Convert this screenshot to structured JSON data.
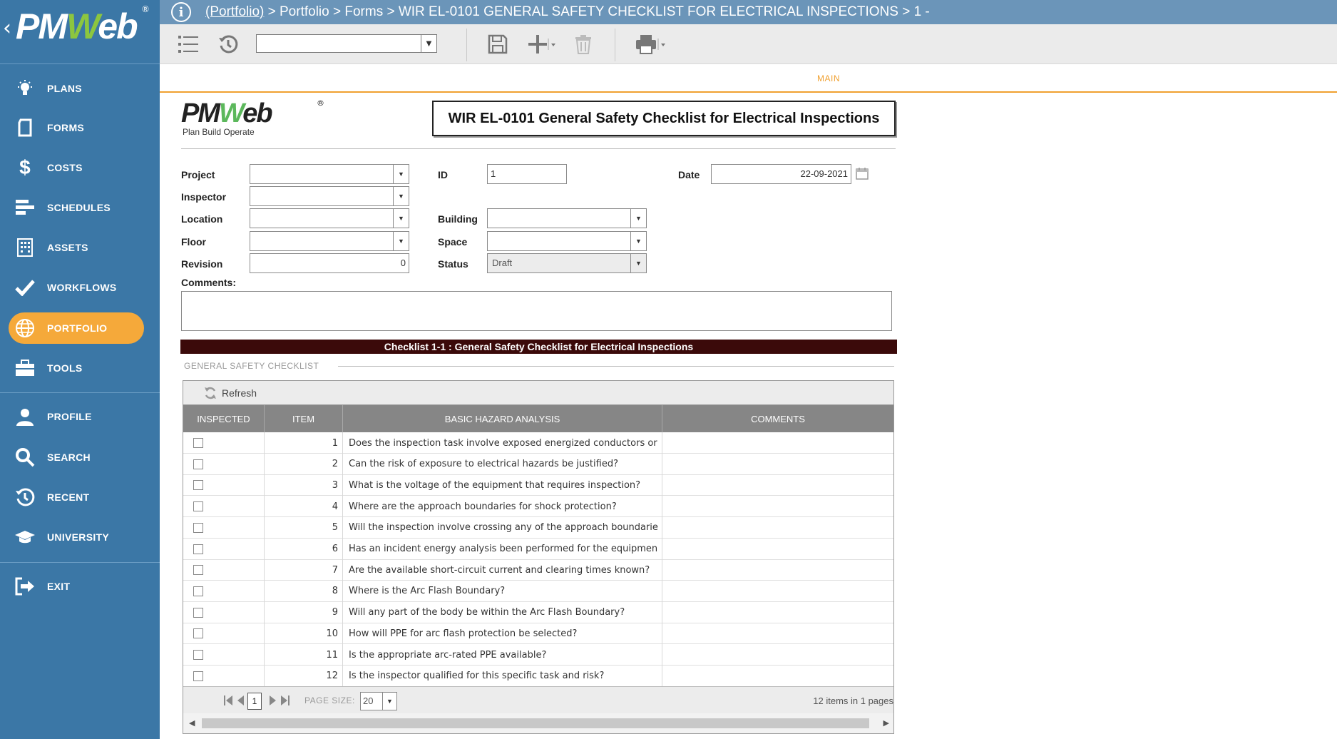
{
  "sidebar": {
    "brand": "PMWeb",
    "items": [
      {
        "label": "PLANS",
        "icon": "lightbulb-icon"
      },
      {
        "label": "FORMS",
        "icon": "document-icon"
      },
      {
        "label": "COSTS",
        "icon": "dollar-icon"
      },
      {
        "label": "SCHEDULES",
        "icon": "schedule-bars-icon"
      },
      {
        "label": "ASSETS",
        "icon": "building-icon"
      },
      {
        "label": "WORKFLOWS",
        "icon": "checkmark-icon"
      },
      {
        "label": "PORTFOLIO",
        "icon": "globe-icon",
        "active": true
      },
      {
        "label": "TOOLS",
        "icon": "briefcase-icon"
      },
      {
        "label": "PROFILE",
        "icon": "user-icon"
      },
      {
        "label": "SEARCH",
        "icon": "search-icon"
      },
      {
        "label": "RECENT",
        "icon": "history-icon"
      },
      {
        "label": "UNIVERSITY",
        "icon": "graduation-cap-icon"
      },
      {
        "label": "EXIT",
        "icon": "exit-icon"
      }
    ],
    "active_color": "#f5a93a",
    "bg_color": "#3b77a6"
  },
  "breadcrumb": {
    "link": "(Portfolio)",
    "rest": " > Portfolio > Forms > WIR EL-0101 GENERAL SAFETY CHECKLIST FOR ELECTRICAL INSPECTIONS > 1 -"
  },
  "toolbar": {
    "select_value": ""
  },
  "tabs": {
    "main": "MAIN"
  },
  "form": {
    "logo_brand": "PMWeb",
    "logo_tagline": "Plan Build Operate",
    "title": "WIR EL-0101 General Safety Checklist for Electrical Inspections",
    "fields": {
      "project_label": "Project",
      "project_value": "",
      "inspector_label": "Inspector",
      "inspector_value": "",
      "location_label": "Location",
      "location_value": "",
      "floor_label": "Floor",
      "floor_value": "",
      "revision_label": "Revision",
      "revision_value": "0",
      "id_label": "ID",
      "id_value": "1",
      "building_label": "Building",
      "building_value": "",
      "space_label": "Space",
      "space_value": "",
      "status_label": "Status",
      "status_value": "Draft",
      "date_label": "Date",
      "date_value": "22-09-2021",
      "comments_label": "Comments:",
      "comments_value": ""
    }
  },
  "checklist": {
    "bar_title": "Checklist 1-1 : General Safety Checklist for Electrical Inspections",
    "section_label": "GENERAL SAFETY CHECKLIST",
    "refresh_label": "Refresh",
    "columns": [
      "INSPECTED",
      "ITEM",
      "BASIC HAZARD ANALYSIS",
      "COMMENTS"
    ],
    "rows": [
      {
        "item": "1",
        "text": "Does the inspection task involve exposed energized conductors or",
        "comments": ""
      },
      {
        "item": "2",
        "text": "Can the risk of exposure to electrical hazards be justified?",
        "comments": ""
      },
      {
        "item": "3",
        "text": "What is the voltage of the equipment that requires inspection?",
        "comments": ""
      },
      {
        "item": "4",
        "text": "Where are the approach boundaries for shock protection?",
        "comments": ""
      },
      {
        "item": "5",
        "text": "Will the inspection involve crossing any of the approach boundarie",
        "comments": ""
      },
      {
        "item": "6",
        "text": "Has an incident energy analysis been performed for the equipmen",
        "comments": ""
      },
      {
        "item": "7",
        "text": "Are the available short-circuit current and clearing times known?",
        "comments": ""
      },
      {
        "item": "8",
        "text": "Where is the Arc Flash Boundary?",
        "comments": ""
      },
      {
        "item": "9",
        "text": "Will any part of the body be within the Arc Flash Boundary?",
        "comments": ""
      },
      {
        "item": "10",
        "text": "How will PPE for arc flash protection be selected?",
        "comments": ""
      },
      {
        "item": "11",
        "text": "Is the appropriate arc-rated PPE available?",
        "comments": ""
      },
      {
        "item": "12",
        "text": "Is the inspector qualified for this specific task and risk?",
        "comments": ""
      }
    ],
    "pager": {
      "page": "1",
      "page_size_label": "PAGE SIZE:",
      "page_size": "20",
      "info": "12 items in 1 pages"
    }
  }
}
